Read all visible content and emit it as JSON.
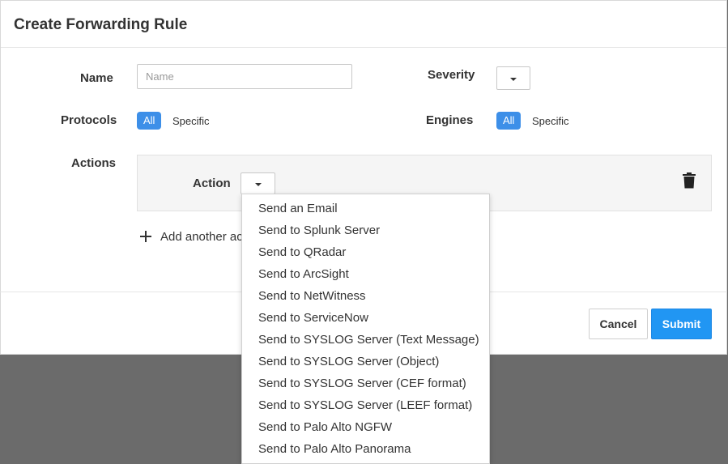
{
  "modal": {
    "title": "Create Forwarding Rule"
  },
  "form": {
    "name_label": "Name",
    "name_placeholder": "Name",
    "name_value": "",
    "severity_label": "Severity",
    "protocols_label": "Protocols",
    "protocols_all": "All",
    "protocols_specific": "Specific",
    "engines_label": "Engines",
    "engines_all": "All",
    "engines_specific": "Specific",
    "actions_label": "Actions",
    "action_label": "Action",
    "add_another_label": "Add another action"
  },
  "footer": {
    "cancel_label": "Cancel",
    "submit_label": "Submit"
  },
  "action_menu": {
    "items": [
      "Send an Email",
      "Send to Splunk Server",
      "Send to QRadar",
      "Send to ArcSight",
      "Send to NetWitness",
      "Send to ServiceNow",
      "Send to SYSLOG Server (Text Message)",
      "Send to SYSLOG Server (Object)",
      "Send to SYSLOG Server (CEF format)",
      "Send to SYSLOG Server (LEEF format)",
      "Send to Palo Alto NGFW",
      "Send to Palo Alto Panorama"
    ]
  },
  "colors": {
    "accent": "#2196f3",
    "pill": "#3d8fe8",
    "backdrop": "#6b6b6b"
  },
  "icons": {
    "trash": "trash-icon",
    "plus": "plus-icon",
    "caret": "caret-down-icon"
  }
}
